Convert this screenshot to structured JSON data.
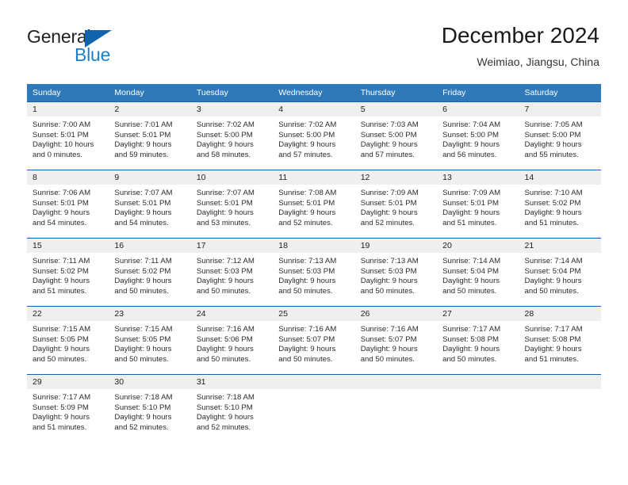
{
  "brand": {
    "name_part1": "General",
    "name_part2": "Blue",
    "accent_color": "#1263ad",
    "secondary_color": "#1d7ec8"
  },
  "header": {
    "title": "December 2024",
    "subtitle": "Weimiao, Jiangsu, China"
  },
  "theme": {
    "header_row_bg": "#3079b8",
    "cell_band_bg": "#efefef",
    "cell_border": "#1263ad"
  },
  "weekday_headers": [
    "Sunday",
    "Monday",
    "Tuesday",
    "Wednesday",
    "Thursday",
    "Friday",
    "Saturday"
  ],
  "weeks": [
    [
      {
        "day": "1",
        "sunrise": "Sunrise: 7:00 AM",
        "sunset": "Sunset: 5:01 PM",
        "daylight_line1": "Daylight: 10 hours",
        "daylight_line2": "and 0 minutes."
      },
      {
        "day": "2",
        "sunrise": "Sunrise: 7:01 AM",
        "sunset": "Sunset: 5:01 PM",
        "daylight_line1": "Daylight: 9 hours",
        "daylight_line2": "and 59 minutes."
      },
      {
        "day": "3",
        "sunrise": "Sunrise: 7:02 AM",
        "sunset": "Sunset: 5:00 PM",
        "daylight_line1": "Daylight: 9 hours",
        "daylight_line2": "and 58 minutes."
      },
      {
        "day": "4",
        "sunrise": "Sunrise: 7:02 AM",
        "sunset": "Sunset: 5:00 PM",
        "daylight_line1": "Daylight: 9 hours",
        "daylight_line2": "and 57 minutes."
      },
      {
        "day": "5",
        "sunrise": "Sunrise: 7:03 AM",
        "sunset": "Sunset: 5:00 PM",
        "daylight_line1": "Daylight: 9 hours",
        "daylight_line2": "and 57 minutes."
      },
      {
        "day": "6",
        "sunrise": "Sunrise: 7:04 AM",
        "sunset": "Sunset: 5:00 PM",
        "daylight_line1": "Daylight: 9 hours",
        "daylight_line2": "and 56 minutes."
      },
      {
        "day": "7",
        "sunrise": "Sunrise: 7:05 AM",
        "sunset": "Sunset: 5:00 PM",
        "daylight_line1": "Daylight: 9 hours",
        "daylight_line2": "and 55 minutes."
      }
    ],
    [
      {
        "day": "8",
        "sunrise": "Sunrise: 7:06 AM",
        "sunset": "Sunset: 5:01 PM",
        "daylight_line1": "Daylight: 9 hours",
        "daylight_line2": "and 54 minutes."
      },
      {
        "day": "9",
        "sunrise": "Sunrise: 7:07 AM",
        "sunset": "Sunset: 5:01 PM",
        "daylight_line1": "Daylight: 9 hours",
        "daylight_line2": "and 54 minutes."
      },
      {
        "day": "10",
        "sunrise": "Sunrise: 7:07 AM",
        "sunset": "Sunset: 5:01 PM",
        "daylight_line1": "Daylight: 9 hours",
        "daylight_line2": "and 53 minutes."
      },
      {
        "day": "11",
        "sunrise": "Sunrise: 7:08 AM",
        "sunset": "Sunset: 5:01 PM",
        "daylight_line1": "Daylight: 9 hours",
        "daylight_line2": "and 52 minutes."
      },
      {
        "day": "12",
        "sunrise": "Sunrise: 7:09 AM",
        "sunset": "Sunset: 5:01 PM",
        "daylight_line1": "Daylight: 9 hours",
        "daylight_line2": "and 52 minutes."
      },
      {
        "day": "13",
        "sunrise": "Sunrise: 7:09 AM",
        "sunset": "Sunset: 5:01 PM",
        "daylight_line1": "Daylight: 9 hours",
        "daylight_line2": "and 51 minutes."
      },
      {
        "day": "14",
        "sunrise": "Sunrise: 7:10 AM",
        "sunset": "Sunset: 5:02 PM",
        "daylight_line1": "Daylight: 9 hours",
        "daylight_line2": "and 51 minutes."
      }
    ],
    [
      {
        "day": "15",
        "sunrise": "Sunrise: 7:11 AM",
        "sunset": "Sunset: 5:02 PM",
        "daylight_line1": "Daylight: 9 hours",
        "daylight_line2": "and 51 minutes."
      },
      {
        "day": "16",
        "sunrise": "Sunrise: 7:11 AM",
        "sunset": "Sunset: 5:02 PM",
        "daylight_line1": "Daylight: 9 hours",
        "daylight_line2": "and 50 minutes."
      },
      {
        "day": "17",
        "sunrise": "Sunrise: 7:12 AM",
        "sunset": "Sunset: 5:03 PM",
        "daylight_line1": "Daylight: 9 hours",
        "daylight_line2": "and 50 minutes."
      },
      {
        "day": "18",
        "sunrise": "Sunrise: 7:13 AM",
        "sunset": "Sunset: 5:03 PM",
        "daylight_line1": "Daylight: 9 hours",
        "daylight_line2": "and 50 minutes."
      },
      {
        "day": "19",
        "sunrise": "Sunrise: 7:13 AM",
        "sunset": "Sunset: 5:03 PM",
        "daylight_line1": "Daylight: 9 hours",
        "daylight_line2": "and 50 minutes."
      },
      {
        "day": "20",
        "sunrise": "Sunrise: 7:14 AM",
        "sunset": "Sunset: 5:04 PM",
        "daylight_line1": "Daylight: 9 hours",
        "daylight_line2": "and 50 minutes."
      },
      {
        "day": "21",
        "sunrise": "Sunrise: 7:14 AM",
        "sunset": "Sunset: 5:04 PM",
        "daylight_line1": "Daylight: 9 hours",
        "daylight_line2": "and 50 minutes."
      }
    ],
    [
      {
        "day": "22",
        "sunrise": "Sunrise: 7:15 AM",
        "sunset": "Sunset: 5:05 PM",
        "daylight_line1": "Daylight: 9 hours",
        "daylight_line2": "and 50 minutes."
      },
      {
        "day": "23",
        "sunrise": "Sunrise: 7:15 AM",
        "sunset": "Sunset: 5:05 PM",
        "daylight_line1": "Daylight: 9 hours",
        "daylight_line2": "and 50 minutes."
      },
      {
        "day": "24",
        "sunrise": "Sunrise: 7:16 AM",
        "sunset": "Sunset: 5:06 PM",
        "daylight_line1": "Daylight: 9 hours",
        "daylight_line2": "and 50 minutes."
      },
      {
        "day": "25",
        "sunrise": "Sunrise: 7:16 AM",
        "sunset": "Sunset: 5:07 PM",
        "daylight_line1": "Daylight: 9 hours",
        "daylight_line2": "and 50 minutes."
      },
      {
        "day": "26",
        "sunrise": "Sunrise: 7:16 AM",
        "sunset": "Sunset: 5:07 PM",
        "daylight_line1": "Daylight: 9 hours",
        "daylight_line2": "and 50 minutes."
      },
      {
        "day": "27",
        "sunrise": "Sunrise: 7:17 AM",
        "sunset": "Sunset: 5:08 PM",
        "daylight_line1": "Daylight: 9 hours",
        "daylight_line2": "and 50 minutes."
      },
      {
        "day": "28",
        "sunrise": "Sunrise: 7:17 AM",
        "sunset": "Sunset: 5:08 PM",
        "daylight_line1": "Daylight: 9 hours",
        "daylight_line2": "and 51 minutes."
      }
    ],
    [
      {
        "day": "29",
        "sunrise": "Sunrise: 7:17 AM",
        "sunset": "Sunset: 5:09 PM",
        "daylight_line1": "Daylight: 9 hours",
        "daylight_line2": "and 51 minutes."
      },
      {
        "day": "30",
        "sunrise": "Sunrise: 7:18 AM",
        "sunset": "Sunset: 5:10 PM",
        "daylight_line1": "Daylight: 9 hours",
        "daylight_line2": "and 52 minutes."
      },
      {
        "day": "31",
        "sunrise": "Sunrise: 7:18 AM",
        "sunset": "Sunset: 5:10 PM",
        "daylight_line1": "Daylight: 9 hours",
        "daylight_line2": "and 52 minutes."
      },
      {
        "day": "",
        "sunrise": "",
        "sunset": "",
        "daylight_line1": "",
        "daylight_line2": ""
      },
      {
        "day": "",
        "sunrise": "",
        "sunset": "",
        "daylight_line1": "",
        "daylight_line2": ""
      },
      {
        "day": "",
        "sunrise": "",
        "sunset": "",
        "daylight_line1": "",
        "daylight_line2": ""
      },
      {
        "day": "",
        "sunrise": "",
        "sunset": "",
        "daylight_line1": "",
        "daylight_line2": ""
      }
    ]
  ]
}
